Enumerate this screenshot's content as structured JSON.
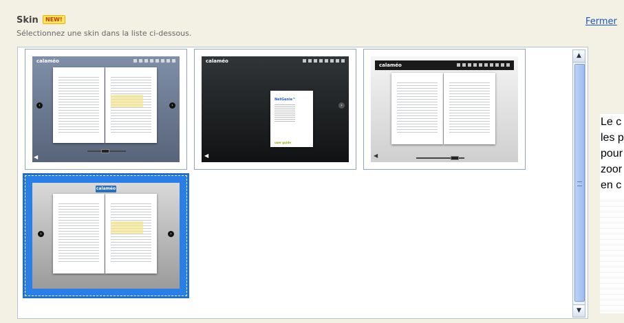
{
  "header": {
    "title": "Skin",
    "badge": "NEW!",
    "subtitle": "Sélectionnez une skin dans la liste ci-dessous.",
    "close_label": "Fermer"
  },
  "skins": [
    {
      "brand": "calaméo",
      "selected": false
    },
    {
      "brand": "calaméo",
      "selected": false
    },
    {
      "brand": "calaméo",
      "selected": false
    },
    {
      "brand": "calaméo",
      "selected": true
    }
  ],
  "cover": {
    "logo": "NetGenie™",
    "footer": "user guide"
  },
  "side_text": [
    "Le c",
    "les p",
    "pour",
    "zoor",
    "en c"
  ],
  "colors": {
    "background": "#f3f1e3",
    "selection": "#2a7fe6",
    "link": "#1a55c4"
  },
  "icons": [
    "chevron-up-icon",
    "chevron-down-icon",
    "speaker-icon",
    "prev-page-icon",
    "next-page-icon"
  ]
}
